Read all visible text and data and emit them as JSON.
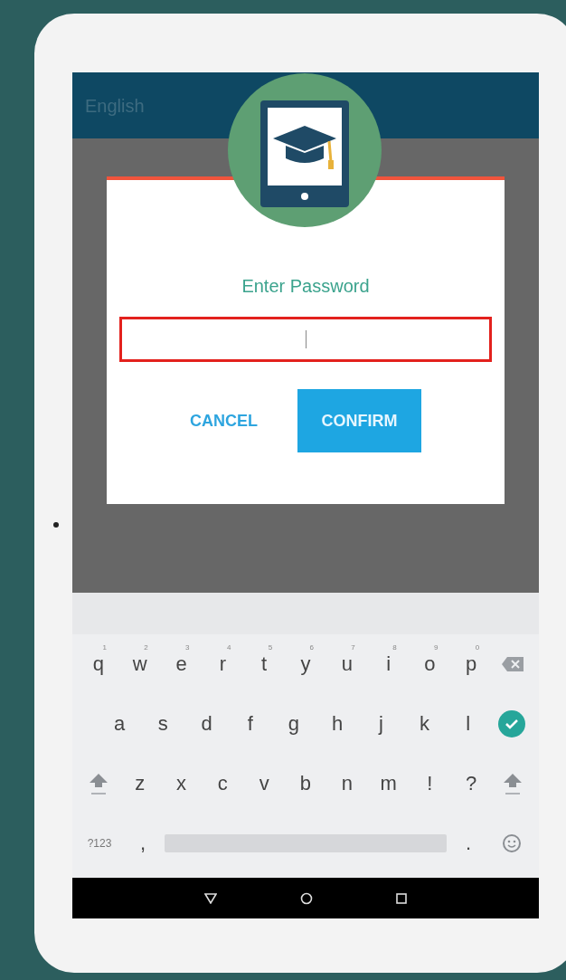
{
  "app_bar": {
    "title": "English"
  },
  "dialog": {
    "title": "Enter Password",
    "password_field": {
      "focused": true
    },
    "buttons": [
      {
        "label": "CANCEL",
        "kind": "text"
      },
      {
        "label": "CONFIRM",
        "kind": "filled"
      }
    ]
  },
  "keyboard": {
    "rows": [
      {
        "keys": [
          {
            "kind": "char",
            "label": "q",
            "hint": "1"
          },
          {
            "kind": "char",
            "label": "w",
            "hint": "2"
          },
          {
            "kind": "char",
            "label": "e",
            "hint": "3"
          },
          {
            "kind": "char",
            "label": "r",
            "hint": "4"
          },
          {
            "kind": "char",
            "label": "t",
            "hint": "5"
          },
          {
            "kind": "char",
            "label": "y",
            "hint": "6"
          },
          {
            "kind": "char",
            "label": "u",
            "hint": "7"
          },
          {
            "kind": "char",
            "label": "i",
            "hint": "8"
          },
          {
            "kind": "char",
            "label": "o",
            "hint": "9"
          },
          {
            "kind": "char",
            "label": "p",
            "hint": "0"
          },
          {
            "kind": "backspace"
          }
        ]
      },
      {
        "keys": [
          {
            "kind": "char",
            "label": "a"
          },
          {
            "kind": "char",
            "label": "s"
          },
          {
            "kind": "char",
            "label": "d"
          },
          {
            "kind": "char",
            "label": "f"
          },
          {
            "kind": "char",
            "label": "g"
          },
          {
            "kind": "char",
            "label": "h"
          },
          {
            "kind": "char",
            "label": "j"
          },
          {
            "kind": "char",
            "label": "k"
          },
          {
            "kind": "char",
            "label": "l"
          },
          {
            "kind": "done"
          }
        ]
      },
      {
        "keys": [
          {
            "kind": "shift"
          },
          {
            "kind": "char",
            "label": "z"
          },
          {
            "kind": "char",
            "label": "x"
          },
          {
            "kind": "char",
            "label": "c"
          },
          {
            "kind": "char",
            "label": "v"
          },
          {
            "kind": "char",
            "label": "b"
          },
          {
            "kind": "char",
            "label": "n"
          },
          {
            "kind": "char",
            "label": "m"
          },
          {
            "kind": "char",
            "label": "!"
          },
          {
            "kind": "char",
            "label": "?"
          },
          {
            "kind": "shift"
          }
        ]
      },
      {
        "keys": [
          {
            "kind": "small",
            "label": "?123"
          },
          {
            "kind": "char",
            "label": ","
          },
          {
            "kind": "space"
          },
          {
            "kind": "char",
            "label": "."
          },
          {
            "kind": "emoji"
          }
        ]
      }
    ]
  }
}
